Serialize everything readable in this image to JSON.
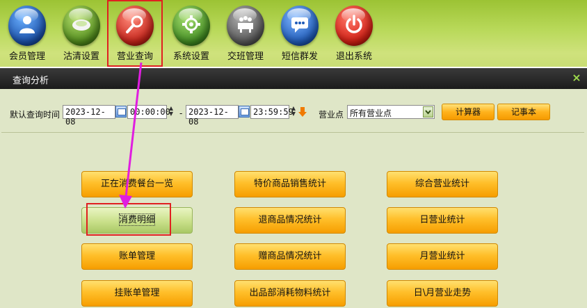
{
  "toolbar": {
    "items": [
      {
        "label": "会员管理",
        "icon": "member-icon"
      },
      {
        "label": "沽清设置",
        "icon": "plate-icon"
      },
      {
        "label": "营业查询",
        "icon": "search-icon"
      },
      {
        "label": "系统设置",
        "icon": "gear-icon"
      },
      {
        "label": "交班管理",
        "icon": "shift-icon"
      },
      {
        "label": "短信群发",
        "icon": "message-icon"
      },
      {
        "label": "退出系统",
        "icon": "power-icon"
      }
    ]
  },
  "panel": {
    "title": "查询分析",
    "close": "×"
  },
  "query": {
    "label": "默认查询时间",
    "start_date": "2023-12-08",
    "start_time": "00:00:00",
    "separator": "-",
    "end_date": "2023-12-08",
    "end_time": "23:59:59",
    "location_label": "营业点",
    "location_value": "所有营业点",
    "calculator_label": "计算器",
    "notepad_label": "记事本"
  },
  "buttons": {
    "col1": [
      "正在消费餐台一览",
      "消费明细",
      "账单管理",
      "挂账单管理"
    ],
    "col2": [
      "特价商品销售统计",
      "退商品情况统计",
      "赠商品情况统计",
      "出品部消耗物料统计"
    ],
    "col3": [
      "综合营业统计",
      "日营业统计",
      "月营业统计",
      "日\\月营业走势"
    ]
  },
  "colors": {
    "accent_orange": "#ffbf2a",
    "selected_green": "#c9e08a",
    "annotation_red": "#e02020",
    "annotation_magenta": "#e01ee0"
  }
}
